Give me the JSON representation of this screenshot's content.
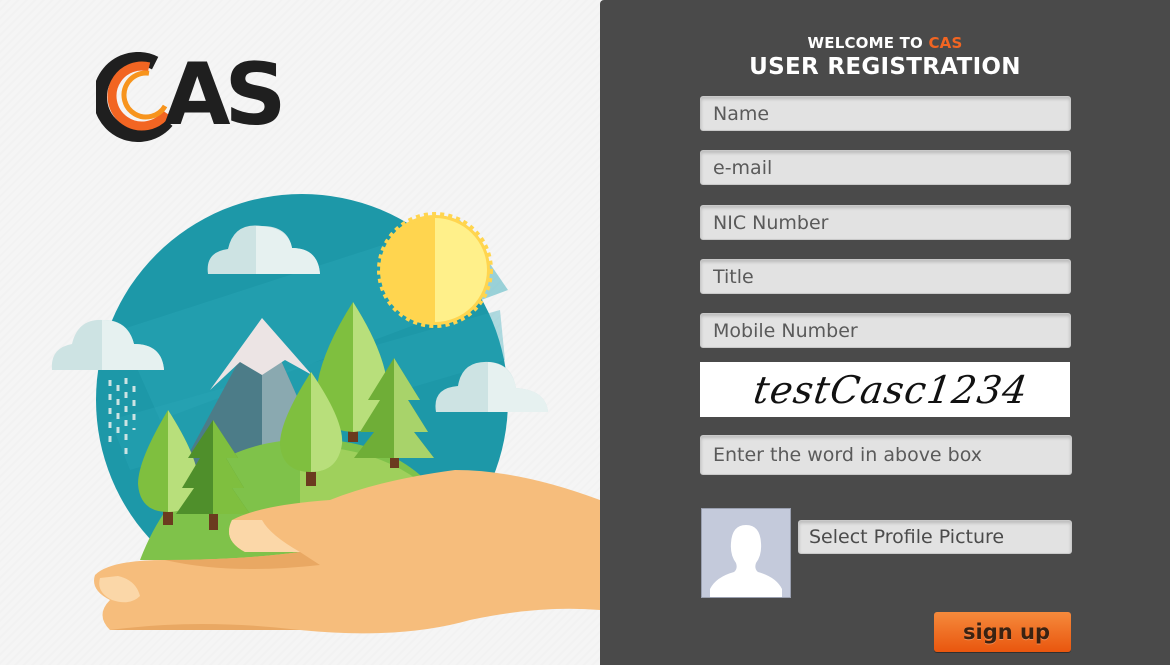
{
  "brand": {
    "logo_text": "AS",
    "colors": {
      "orange": "#f26522",
      "dark": "#1f1f1f"
    }
  },
  "header": {
    "welcome_prefix": "WELCOME TO ",
    "welcome_brand": "CAS",
    "title": "USER REGISTRATION"
  },
  "form": {
    "name_placeholder": "Name",
    "email_placeholder": "e-mail",
    "nic_placeholder": "NIC Number",
    "title_placeholder": "Title",
    "mobile_placeholder": "Mobile Number",
    "captcha_text": "testCasc1234",
    "captcha_input_placeholder": "Enter the word in above box",
    "profile_picture_label": "Select Profile Picture",
    "signup_label": "sign up"
  },
  "icons": {
    "avatar": "default-user-silhouette-icon"
  },
  "theme": {
    "panel_bg": "#4a4a4a",
    "field_bg": "#e2e2e2",
    "button_color": "#f26522"
  }
}
